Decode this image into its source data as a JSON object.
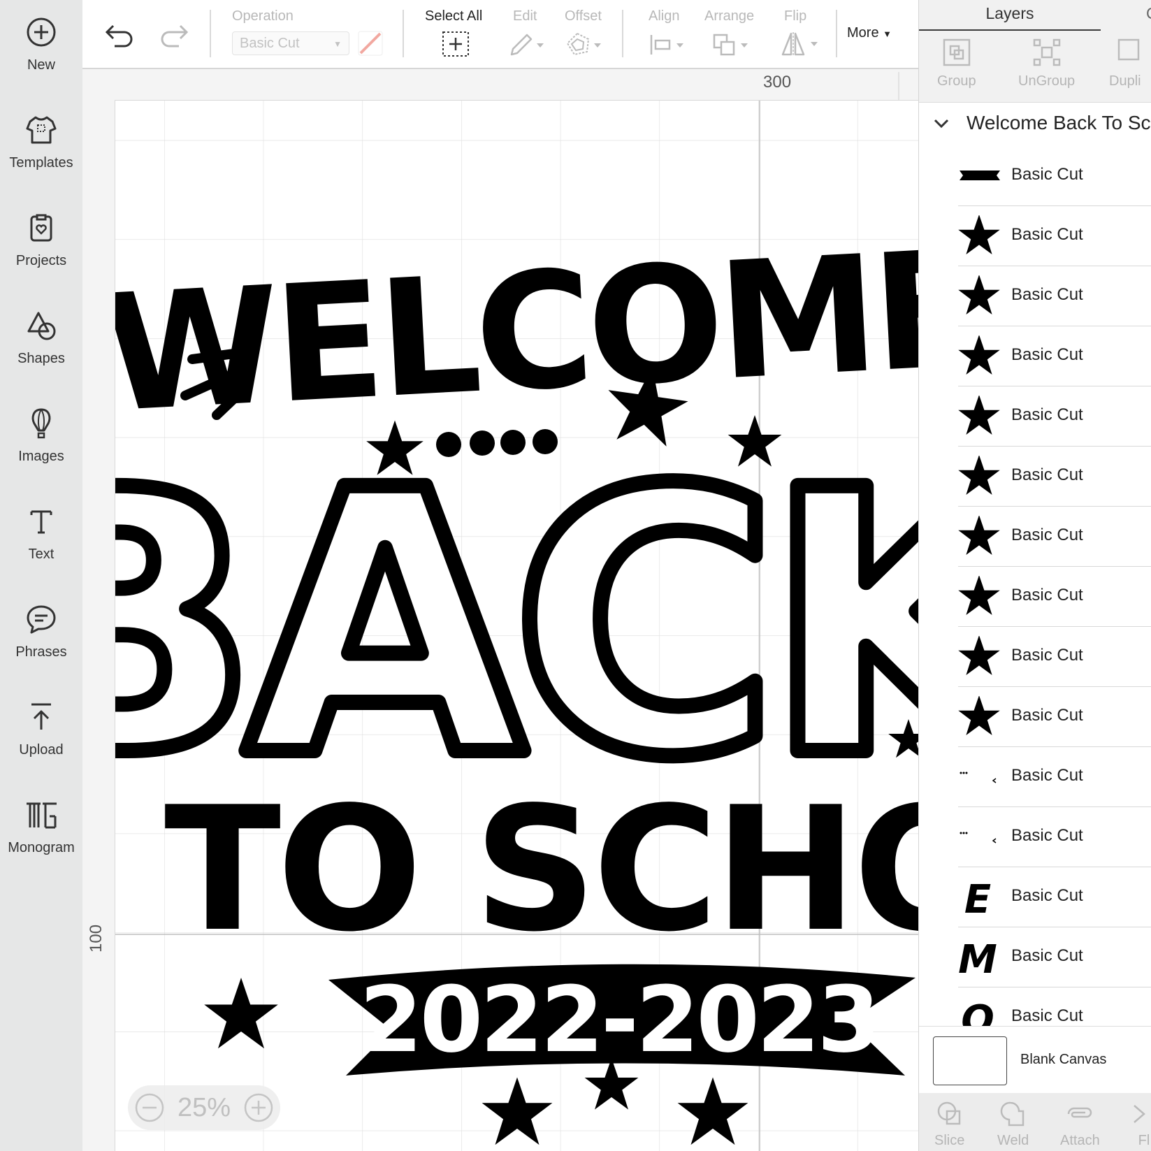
{
  "sidebar": {
    "items": [
      {
        "label": "New",
        "icon": "plus-circle-icon"
      },
      {
        "label": "Templates",
        "icon": "tshirt-icon"
      },
      {
        "label": "Projects",
        "icon": "projects-icon"
      },
      {
        "label": "Shapes",
        "icon": "shapes-icon"
      },
      {
        "label": "Images",
        "icon": "balloon-icon"
      },
      {
        "label": "Text",
        "icon": "text-icon"
      },
      {
        "label": "Phrases",
        "icon": "speech-bubble-icon"
      },
      {
        "label": "Upload",
        "icon": "upload-icon"
      },
      {
        "label": "Monogram",
        "icon": "monogram-icon"
      }
    ]
  },
  "toolbar": {
    "operation_label": "Operation",
    "operation_value": "Basic Cut",
    "select_all_label": "Select All",
    "edit_label": "Edit",
    "offset_label": "Offset",
    "align_label": "Align",
    "arrange_label": "Arrange",
    "flip_label": "Flip",
    "more_label": "More"
  },
  "canvas": {
    "ruler_top_value": "300",
    "ruler_left_value": "100",
    "zoom": "25%",
    "design": {
      "line1": "WELCOME",
      "line2": "BACK",
      "line3": "TO SCHOOL",
      "banner": "2022-2023"
    }
  },
  "layers": {
    "tab_active": "Layers",
    "tab_other": "C",
    "actions": [
      {
        "label": "Group",
        "icon": "group-icon"
      },
      {
        "label": "UnGroup",
        "icon": "ungroup-icon"
      },
      {
        "label": "Dupli",
        "icon": "duplicate-icon"
      }
    ],
    "group_title": "Welcome Back To Sc",
    "rows": [
      {
        "thumb": "banner",
        "label": "Basic Cut"
      },
      {
        "thumb": "star",
        "label": "Basic Cut"
      },
      {
        "thumb": "star",
        "label": "Basic Cut"
      },
      {
        "thumb": "star",
        "label": "Basic Cut"
      },
      {
        "thumb": "star",
        "label": "Basic Cut"
      },
      {
        "thumb": "star",
        "label": "Basic Cut"
      },
      {
        "thumb": "star",
        "label": "Basic Cut"
      },
      {
        "thumb": "star",
        "label": "Basic Cut"
      },
      {
        "thumb": "star",
        "label": "Basic Cut"
      },
      {
        "thumb": "star",
        "label": "Basic Cut"
      },
      {
        "thumb": "dots",
        "label": "Basic Cut"
      },
      {
        "thumb": "dots",
        "label": "Basic Cut"
      },
      {
        "thumb": "letter",
        "letter": "E",
        "label": "Basic Cut"
      },
      {
        "thumb": "letter",
        "letter": "M",
        "label": "Basic Cut"
      },
      {
        "thumb": "letter",
        "letter": "O",
        "label": "Basic Cut"
      }
    ],
    "blank_canvas_label": "Blank Canvas",
    "bottom_actions": [
      {
        "label": "Slice",
        "icon": "slice-icon"
      },
      {
        "label": "Weld",
        "icon": "weld-icon"
      },
      {
        "label": "Attach",
        "icon": "attach-icon"
      },
      {
        "label": "Fl",
        "icon": "flatten-icon"
      }
    ]
  }
}
